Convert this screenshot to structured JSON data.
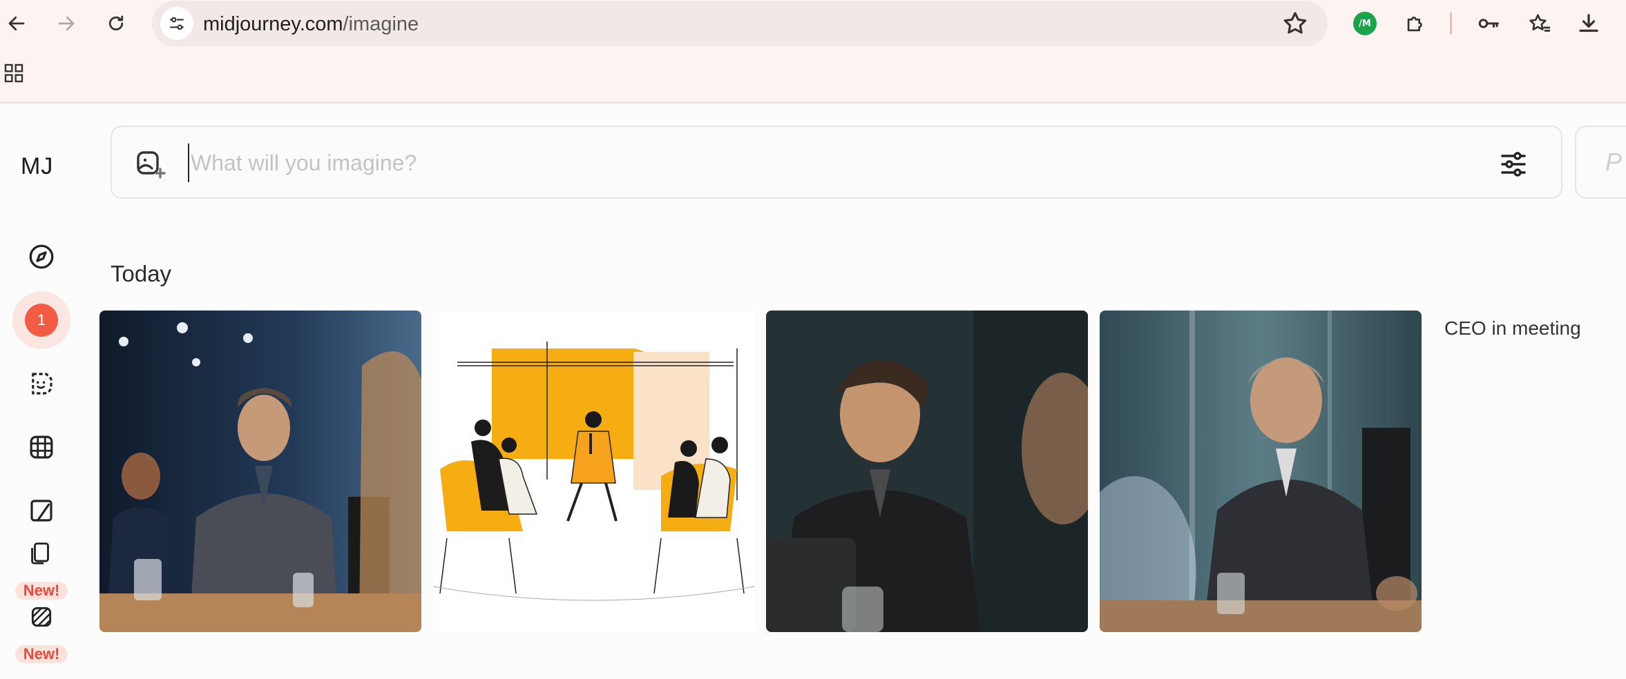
{
  "browser": {
    "url_domain": "midjourney.com",
    "url_path": "/imagine",
    "extension_badge": "/M"
  },
  "app": {
    "logo": "MJ",
    "notification_count": "1",
    "new_badges": [
      "New!",
      "New!"
    ],
    "search": {
      "placeholder": "What will you imagine?",
      "value": ""
    },
    "side_panel_letter": "P",
    "section_title": "Today",
    "job": {
      "prompt": "CEO in meeting",
      "images": [
        {
          "icon": "photo-ceo-at-table"
        },
        {
          "icon": "illustration-meeting-circle"
        },
        {
          "icon": "photo-ceo-portrait"
        },
        {
          "icon": "photo-ceo-grey-hair"
        }
      ]
    }
  },
  "colors": {
    "accent": "#f25b44",
    "badge_bg": "#fde2dc",
    "chrome_bg": "#fdf3f1",
    "extension_green": "#1aa34a"
  }
}
